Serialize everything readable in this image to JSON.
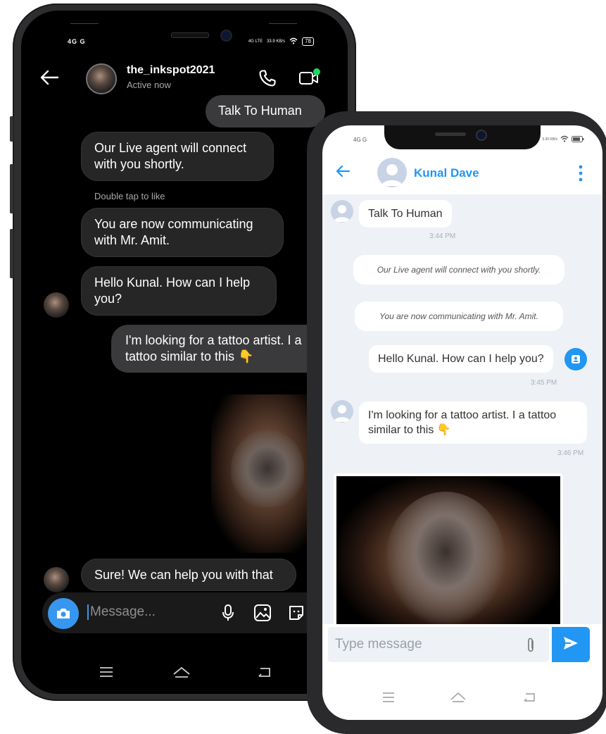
{
  "instagram": {
    "status": {
      "signal_left": "4G",
      "signal_left2": "G",
      "network": "4G LTE",
      "speed": "33.9 KB/s",
      "battery": "78"
    },
    "header": {
      "username": "the_inkspot2021",
      "status": "Active now"
    },
    "messages": [
      {
        "text": "Talk To Human",
        "side": "right"
      },
      {
        "text": "Our Live agent will connect with you shortly.",
        "side": "left"
      },
      {
        "text": "You are now communicating with Mr. Amit.",
        "side": "left"
      },
      {
        "text": "Hello Kunal. How can I help you?",
        "side": "left"
      },
      {
        "text": "I'm looking for a tattoo artist. I a tattoo similar to this 👇",
        "side": "right"
      },
      {
        "text": "Sure! We can help you with that",
        "side": "left"
      }
    ],
    "hint": "Double tap to like",
    "composer": {
      "placeholder": "Message..."
    },
    "icons": [
      "back-arrow-icon",
      "phone-icon",
      "video-icon",
      "camera-icon",
      "mic-icon",
      "gallery-icon",
      "sticker-icon"
    ]
  },
  "webchat": {
    "status": {
      "signal": "4G",
      "signal2": "G",
      "speed": "3.30 KB/s"
    },
    "header": {
      "name": "Kunal Dave"
    },
    "messages": [
      {
        "text": "Talk To Human",
        "time": "3:44 PM",
        "from": "user"
      },
      {
        "text": "Our Live agent will connect with you shortly.",
        "from": "system"
      },
      {
        "text": "You are now communicating with Mr. Amit.",
        "from": "system"
      },
      {
        "text": "Hello Kunal. How can I help you?",
        "time": "3:45 PM",
        "from": "agent"
      },
      {
        "text": "I'm looking for a tattoo artist. I a tattoo similar to this 👇",
        "time": "3:46 PM",
        "from": "user"
      }
    ],
    "composer": {
      "placeholder": "Type message"
    },
    "colors": {
      "accent": "#2196f3",
      "background": "#eef1f5"
    },
    "icons": [
      "back-arrow-icon",
      "kebab-menu-icon",
      "paperclip-icon",
      "send-icon",
      "agent-badge-icon"
    ]
  }
}
